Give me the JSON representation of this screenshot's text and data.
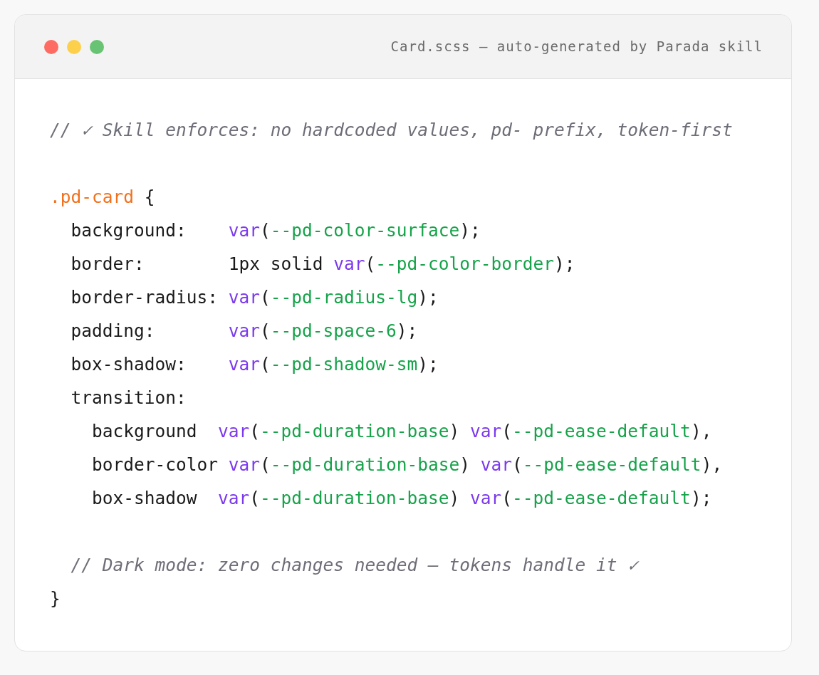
{
  "window": {
    "title": "Card.scss — auto-generated by Parada skill",
    "controls": [
      {
        "color": "#fe6b63"
      },
      {
        "color": "#fdd04b"
      },
      {
        "color": "#68c474"
      }
    ]
  },
  "code": {
    "lines": [
      {
        "kind": "code",
        "tokens": [
          {
            "kind": "comment",
            "text": "// ✓ Skill enforces: no hardcoded values, pd- prefix, token-first"
          }
        ]
      },
      {
        "kind": "blank"
      },
      {
        "kind": "code",
        "tokens": [
          {
            "kind": "selector",
            "text": ".pd-card"
          },
          {
            "kind": "plain",
            "text": " {"
          }
        ]
      },
      {
        "kind": "code",
        "tokens": [
          {
            "kind": "plain",
            "text": "  background:    "
          },
          {
            "kind": "function",
            "text": "var"
          },
          {
            "kind": "plain",
            "text": "("
          },
          {
            "kind": "variable",
            "text": "--pd-color-surface"
          },
          {
            "kind": "plain",
            "text": ");"
          }
        ]
      },
      {
        "kind": "code",
        "tokens": [
          {
            "kind": "plain",
            "text": "  border:        1px solid "
          },
          {
            "kind": "function",
            "text": "var"
          },
          {
            "kind": "plain",
            "text": "("
          },
          {
            "kind": "variable",
            "text": "--pd-color-border"
          },
          {
            "kind": "plain",
            "text": ");"
          }
        ]
      },
      {
        "kind": "code",
        "tokens": [
          {
            "kind": "plain",
            "text": "  border-radius: "
          },
          {
            "kind": "function",
            "text": "var"
          },
          {
            "kind": "plain",
            "text": "("
          },
          {
            "kind": "variable",
            "text": "--pd-radius-lg"
          },
          {
            "kind": "plain",
            "text": ");"
          }
        ]
      },
      {
        "kind": "code",
        "tokens": [
          {
            "kind": "plain",
            "text": "  padding:       "
          },
          {
            "kind": "function",
            "text": "var"
          },
          {
            "kind": "plain",
            "text": "("
          },
          {
            "kind": "variable",
            "text": "--pd-space-6"
          },
          {
            "kind": "plain",
            "text": ");"
          }
        ]
      },
      {
        "kind": "code",
        "tokens": [
          {
            "kind": "plain",
            "text": "  box-shadow:    "
          },
          {
            "kind": "function",
            "text": "var"
          },
          {
            "kind": "plain",
            "text": "("
          },
          {
            "kind": "variable",
            "text": "--pd-shadow-sm"
          },
          {
            "kind": "plain",
            "text": ");"
          }
        ]
      },
      {
        "kind": "code",
        "tokens": [
          {
            "kind": "plain",
            "text": "  transition:"
          }
        ]
      },
      {
        "kind": "code",
        "tokens": [
          {
            "kind": "plain",
            "text": "    background  "
          },
          {
            "kind": "function",
            "text": "var"
          },
          {
            "kind": "plain",
            "text": "("
          },
          {
            "kind": "variable",
            "text": "--pd-duration-base"
          },
          {
            "kind": "plain",
            "text": ") "
          },
          {
            "kind": "function",
            "text": "var"
          },
          {
            "kind": "plain",
            "text": "("
          },
          {
            "kind": "variable",
            "text": "--pd-ease-default"
          },
          {
            "kind": "plain",
            "text": "),"
          }
        ]
      },
      {
        "kind": "code",
        "tokens": [
          {
            "kind": "plain",
            "text": "    border-color "
          },
          {
            "kind": "function",
            "text": "var"
          },
          {
            "kind": "plain",
            "text": "("
          },
          {
            "kind": "variable",
            "text": "--pd-duration-base"
          },
          {
            "kind": "plain",
            "text": ") "
          },
          {
            "kind": "function",
            "text": "var"
          },
          {
            "kind": "plain",
            "text": "("
          },
          {
            "kind": "variable",
            "text": "--pd-ease-default"
          },
          {
            "kind": "plain",
            "text": "),"
          }
        ]
      },
      {
        "kind": "code",
        "tokens": [
          {
            "kind": "plain",
            "text": "    box-shadow  "
          },
          {
            "kind": "function",
            "text": "var"
          },
          {
            "kind": "plain",
            "text": "("
          },
          {
            "kind": "variable",
            "text": "--pd-duration-base"
          },
          {
            "kind": "plain",
            "text": ") "
          },
          {
            "kind": "function",
            "text": "var"
          },
          {
            "kind": "plain",
            "text": "("
          },
          {
            "kind": "variable",
            "text": "--pd-ease-default"
          },
          {
            "kind": "plain",
            "text": ");"
          }
        ]
      },
      {
        "kind": "blank"
      },
      {
        "kind": "code",
        "tokens": [
          {
            "kind": "comment",
            "text": "  // Dark mode: zero changes needed — tokens handle it ✓"
          }
        ]
      },
      {
        "kind": "code",
        "tokens": [
          {
            "kind": "plain",
            "text": "}"
          }
        ]
      }
    ]
  }
}
